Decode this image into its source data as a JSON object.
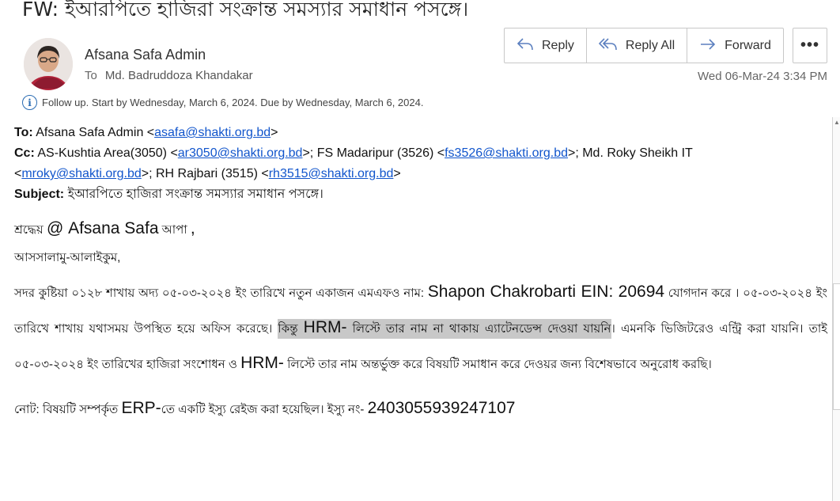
{
  "email": {
    "subject": "FW: ইআরপিতে হাজিরা সংক্রান্ত সমস্যার সমাধান পসঙ্গে।",
    "sender": "Afsana Safa Admin",
    "to_label": "To",
    "to": "Md. Badruddoza Khandakar",
    "datetime": "Wed 06-Mar-24 3:34 PM",
    "followup": "Follow up.  Start by Wednesday, March 6, 2024.  Due by Wednesday, March 6, 2024."
  },
  "actions": {
    "reply": "Reply",
    "reply_all": "Reply All",
    "forward": "Forward",
    "more": "•••"
  },
  "fwd": {
    "to_label": "To:",
    "to_name": " Afsana Safa Admin <",
    "to_email": "asafa@shakti.org.bd",
    "to_end": ">",
    "cc_label": "Cc:",
    "cc_1": " AS-Kushtia Area(3050) <",
    "cc_email_1": "ar3050@shakti.org.bd",
    "cc_2": ">; FS Madaripur (3526) <",
    "cc_email_2": "fs3526@shakti.org.bd",
    "cc_3": ">; Md. Roky Sheikh IT",
    "cc_4": "<",
    "cc_email_3": "mroky@shakti.org.bd",
    "cc_5": ">; RH Rajbari (3515) <",
    "cc_email_4": "rh3515@shakti.org.bd",
    "cc_6": ">",
    "subject_label": "Subject:",
    "subject": " ইআরপিতে হাজিরা সংক্রান্ত সমস্যার সমাধান পসঙ্গে।"
  },
  "message": {
    "greet_1": "শ্রদ্ধেয় ",
    "greet_name": "@ Afsana Safa",
    "greet_2": " আপা ",
    "greet_3": ",",
    "salam": "আসসালামু-আলাইকুম,",
    "p1_a": "সদর কুষ্টিয়া ০১২৮ শাখায় অদ্য ০৫-০৩-২০২৪ ইং তারিখে নতুন একাজন এমএফও নাম: ",
    "p1_name": "Shapon Chakrobarti EIN: 20694",
    "p1_b": " যোগদান করে । ০৫-০৩-২০২৪ ইং তারিখে শাখায় যথাসময় উপস্থিত হয়ে অফিস করেছে। ",
    "hl_a": "কিন্তু ",
    "hl_hrm": "HRM-",
    "hl_b": " লিস্টে তার নাম না থাকায়  এ্যাটেনডেন্স দেওয়া যায়নি",
    "p1_c": "। এমনকি ভিজিটরেও এন্ট্রি করা যায়নি। তাই ০৫-০৩-২০২৪ ইং তারিখের হাজিরা সংশোধন ও ",
    "p1_hrm": "HRM-",
    "p1_d": " লিস্টে তার নাম অন্তর্ভুক্ত করে বিষয়টি সমাধান করে দেওয়র জন্য বিশেষভাবে অনুরোধ করছি।",
    "note_a": "নোট: বিষয়টি সম্পর্কৃত ",
    "note_erp": "ERP-",
    "note_b": "তে একটি ইস্যু রেইজ করা হয়েছিল। ইস্যু নং- ",
    "note_num": "2403055939247107"
  },
  "colors": {
    "link": "#1155cc",
    "accent_icon": "#5b7fbf",
    "highlight": "#c8c8c8"
  },
  "icons": [
    "reply-icon",
    "reply-all-icon",
    "forward-icon",
    "more-icon",
    "info-icon"
  ]
}
